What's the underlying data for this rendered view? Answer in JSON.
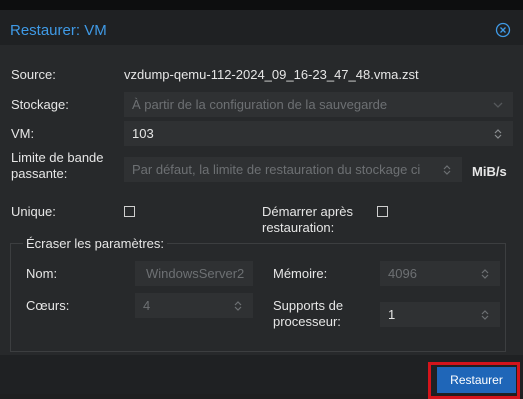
{
  "dialog": {
    "title": "Restaurer: VM"
  },
  "form": {
    "source_label": "Source:",
    "source_value": "vzdump-qemu-112-2024_09_16-23_47_48.vma.zst",
    "storage_label": "Stockage:",
    "storage_value": "À partir de la configuration de la sauvegarde",
    "vm_label": "VM:",
    "vm_value": "103",
    "bandwidth_label_line1": "Limite de bande",
    "bandwidth_label_line2": "passante:",
    "bandwidth_placeholder": "Par défaut, la limite de restauration du stockage ci",
    "bandwidth_unit": "MiB/s",
    "unique_label": "Unique:",
    "start_label_line1": "Démarrer après",
    "start_label_line2": "restauration:"
  },
  "override": {
    "legend": "Écraser les paramètres:",
    "name_label": "Nom:",
    "name_placeholder": "WindowsServer2",
    "memory_label": "Mémoire:",
    "memory_placeholder": "4096",
    "cores_label": "Cœurs:",
    "cores_placeholder": "4",
    "sockets_label_line1": "Supports de",
    "sockets_label_line2": "processeur:",
    "sockets_value": "1"
  },
  "footer": {
    "restore_label": "Restaurer"
  },
  "icons": {
    "close": "close-circle-icon",
    "dropdown": "chevron-down-icon",
    "spinner": "spinner-arrows-icon"
  },
  "colors": {
    "accent": "#3f9ae6",
    "button": "#1f66b8",
    "highlight": "#d4141b"
  }
}
